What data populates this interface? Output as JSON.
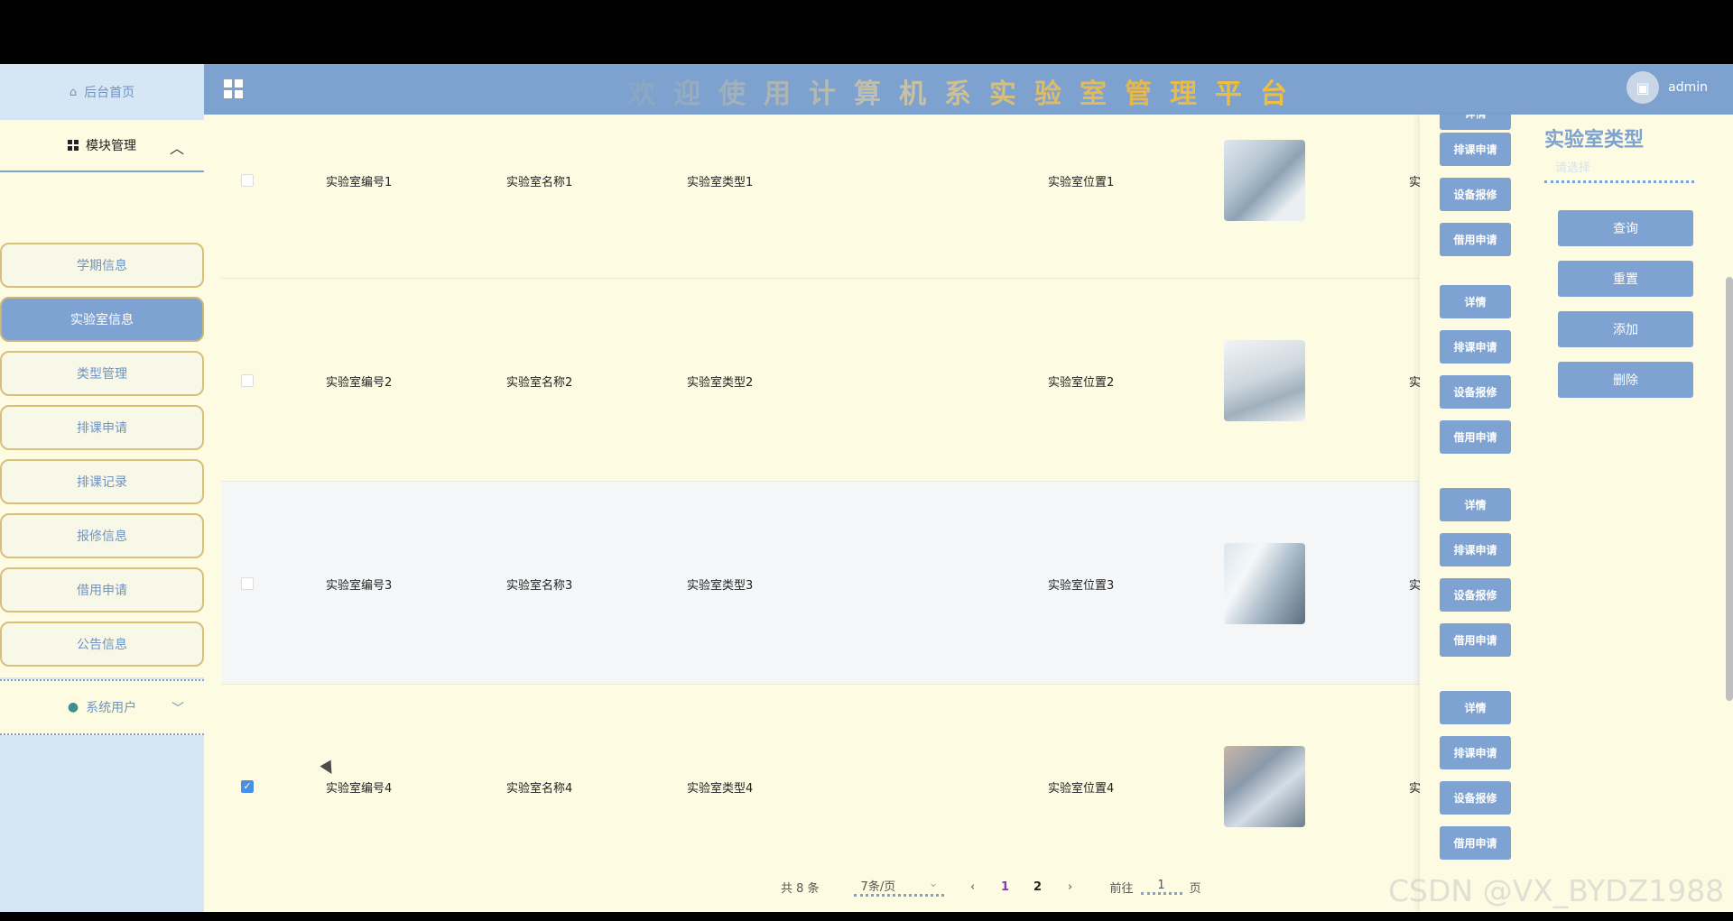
{
  "sidebar": {
    "home": "后台首页",
    "module": "模块管理",
    "items": [
      {
        "label": "学期信息"
      },
      {
        "label": "实验室信息"
      },
      {
        "label": "类型管理"
      },
      {
        "label": "排课申请"
      },
      {
        "label": "排课记录"
      },
      {
        "label": "报修信息"
      },
      {
        "label": "借用申请"
      },
      {
        "label": "公告信息"
      }
    ],
    "system_user": "系统用户"
  },
  "header": {
    "title": "欢迎使用计算机系实验室管理平台",
    "user": "admin"
  },
  "table": {
    "rows": [
      {
        "code": "实验室编号1",
        "name": "实验室名称1",
        "type": "实验室类型1",
        "location": "实验室位置1",
        "trunc": "实",
        "checked": false
      },
      {
        "code": "实验室编号2",
        "name": "实验室名称2",
        "type": "实验室类型2",
        "location": "实验室位置2",
        "trunc": "实",
        "checked": false
      },
      {
        "code": "实验室编号3",
        "name": "实验室名称3",
        "type": "实验室类型3",
        "location": "实验室位置3",
        "trunc": "实",
        "checked": false
      },
      {
        "code": "实验室编号4",
        "name": "实验室名称4",
        "type": "实验室类型4",
        "location": "实验室位置4",
        "trunc": "实",
        "checked": true
      }
    ]
  },
  "ops": {
    "detail": "详情",
    "schedule": "排课申请",
    "repair": "设备报修",
    "borrow": "借用申请"
  },
  "panel": {
    "title": "实验室类型",
    "placeholder": "请选择",
    "query": "查询",
    "reset": "重置",
    "add": "添加",
    "delete": "删除"
  },
  "pager": {
    "total": "共 8 条",
    "size": "7条/页",
    "page1": "1",
    "page2": "2",
    "goto_label": "前往",
    "goto_value": "1",
    "goto_suffix": "页"
  },
  "watermark": "CSDN @VX_BYDZ1988",
  "colors": {
    "accent": "#7ea2d2",
    "background": "#fdfbe1",
    "sidebar": "#d6e6f5"
  }
}
